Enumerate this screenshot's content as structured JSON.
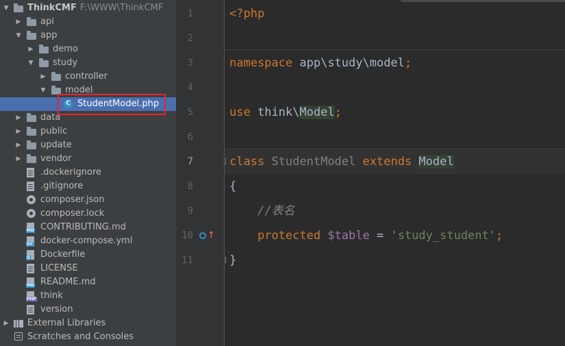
{
  "project": {
    "name": "ThinkCMF",
    "path": "F:\\WWW\\ThinkCMF"
  },
  "tree": [
    {
      "label": "api",
      "type": "folder",
      "indent": 1,
      "expanded": false
    },
    {
      "label": "app",
      "type": "folder",
      "indent": 1,
      "expanded": true
    },
    {
      "label": "demo",
      "type": "folder",
      "indent": 2,
      "expanded": false
    },
    {
      "label": "study",
      "type": "folder",
      "indent": 2,
      "expanded": true
    },
    {
      "label": "controller",
      "type": "folder",
      "indent": 3,
      "expanded": false
    },
    {
      "label": "model",
      "type": "folder",
      "indent": 3,
      "expanded": true
    },
    {
      "label": "StudentModel.php",
      "type": "class",
      "indent": 4,
      "selected": true
    },
    {
      "label": "data",
      "type": "folder",
      "indent": 1,
      "expanded": false
    },
    {
      "label": "public",
      "type": "folder",
      "indent": 1,
      "expanded": false
    },
    {
      "label": "update",
      "type": "folder",
      "indent": 1,
      "expanded": false
    },
    {
      "label": "vendor",
      "type": "folder",
      "indent": 1,
      "expanded": false
    },
    {
      "label": ".dockerignore",
      "type": "file",
      "indent": 1
    },
    {
      "label": ".gitignore",
      "type": "file",
      "indent": 1
    },
    {
      "label": "composer.json",
      "type": "gear",
      "indent": 1
    },
    {
      "label": "composer.lock",
      "type": "gear",
      "indent": 1
    },
    {
      "label": "CONTRIBUTING.md",
      "type": "md",
      "indent": 1
    },
    {
      "label": "docker-compose.yml",
      "type": "dc",
      "indent": 1
    },
    {
      "label": "Dockerfile",
      "type": "docker",
      "indent": 1
    },
    {
      "label": "LICENSE",
      "type": "file",
      "indent": 1
    },
    {
      "label": "README.md",
      "type": "md",
      "indent": 1
    },
    {
      "label": "think",
      "type": "php",
      "indent": 1
    },
    {
      "label": "version",
      "type": "file",
      "indent": 1
    }
  ],
  "bottom_nodes": {
    "external_libraries": "External Libraries",
    "scratches": "Scratches and Consoles"
  },
  "badges": {
    "md": "MD",
    "php": "PHP",
    "dc": "DC",
    "docker": "D",
    "class": "C"
  },
  "editor": {
    "line_numbers": [
      "1",
      "2",
      "3",
      "4",
      "5",
      "6",
      "7",
      "8",
      "9",
      "10",
      "11"
    ],
    "current_line": "7",
    "code": {
      "l1_open": "<?php",
      "l3_kw": "namespace",
      "l3_ns": "app\\study\\model",
      "l3_semi": ";",
      "l5_kw": "use",
      "l5_ns": "think\\",
      "l5_ref": "Model",
      "l5_semi": ";",
      "l7_kw": "class",
      "l7_name": "StudentModel",
      "l7_ext": "extends",
      "l7_ref": "Model",
      "l8_brace": "{",
      "l9_comment": "//表名",
      "l10_kw": "protected",
      "l10_var": "$table",
      "l10_eq": " = ",
      "l10_str": "'study_student'",
      "l10_semi": ";",
      "l11_brace": "}"
    }
  },
  "colors": {
    "keyword": "#cc7832",
    "string": "#6a8759",
    "variable": "#9876aa",
    "comment": "#808080",
    "selection": "#4b6eaf",
    "highlight_box": "#e8252a"
  }
}
